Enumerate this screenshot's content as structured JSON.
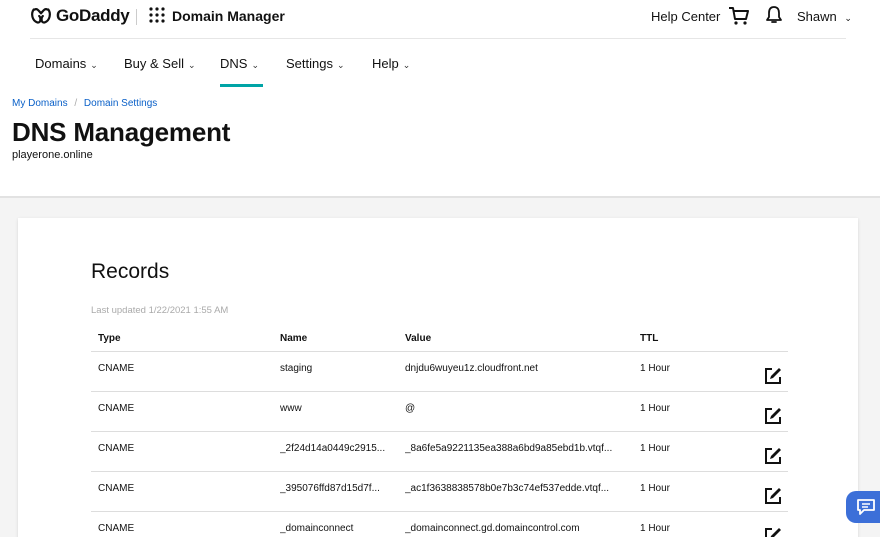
{
  "header": {
    "brand": "GoDaddy",
    "app_name": "Domain Manager",
    "help_center": "Help Center",
    "user_name": "Shawn",
    "icons": [
      "godaddy-logo",
      "apps-grid-icon",
      "cart-icon",
      "bell-icon",
      "chevron-down-icon"
    ]
  },
  "nav": {
    "items": [
      {
        "label": "Domains"
      },
      {
        "label": "Buy & Sell"
      },
      {
        "label": "DNS"
      },
      {
        "label": "Settings"
      },
      {
        "label": "Help"
      }
    ],
    "active": "DNS",
    "accent_color": "#00a4a6"
  },
  "breadcrumb": {
    "items": [
      "My Domains",
      "Domain Settings"
    ]
  },
  "page": {
    "title": "DNS Management",
    "domain": "playerone.online"
  },
  "records": {
    "title": "Records",
    "last_updated": "Last updated 1/22/2021 1:55 AM",
    "columns": [
      "Type",
      "Name",
      "Value",
      "TTL"
    ],
    "rows": [
      {
        "type": "CNAME",
        "name": "staging",
        "value": "dnjdu6wuyeu1z.cloudfront.net",
        "ttl": "1 Hour"
      },
      {
        "type": "CNAME",
        "name": "www",
        "value": "@",
        "ttl": "1 Hour"
      },
      {
        "type": "CNAME",
        "name": "_2f24d14a0449c2915...",
        "value": "_8a6fe5a9221135ea388a6bd9a85ebd1b.vtqf...",
        "ttl": "1 Hour"
      },
      {
        "type": "CNAME",
        "name": "_395076ffd87d15d7f...",
        "value": "_ac1f3638838578b0e7b3c74ef537edde.vtqf...",
        "ttl": "1 Hour"
      },
      {
        "type": "CNAME",
        "name": "_domainconnect",
        "value": "_domainconnect.gd.domaincontrol.com",
        "ttl": "1 Hour"
      }
    ]
  },
  "chat": {
    "icon": "chat-icon",
    "color": "#3c6fd8"
  }
}
